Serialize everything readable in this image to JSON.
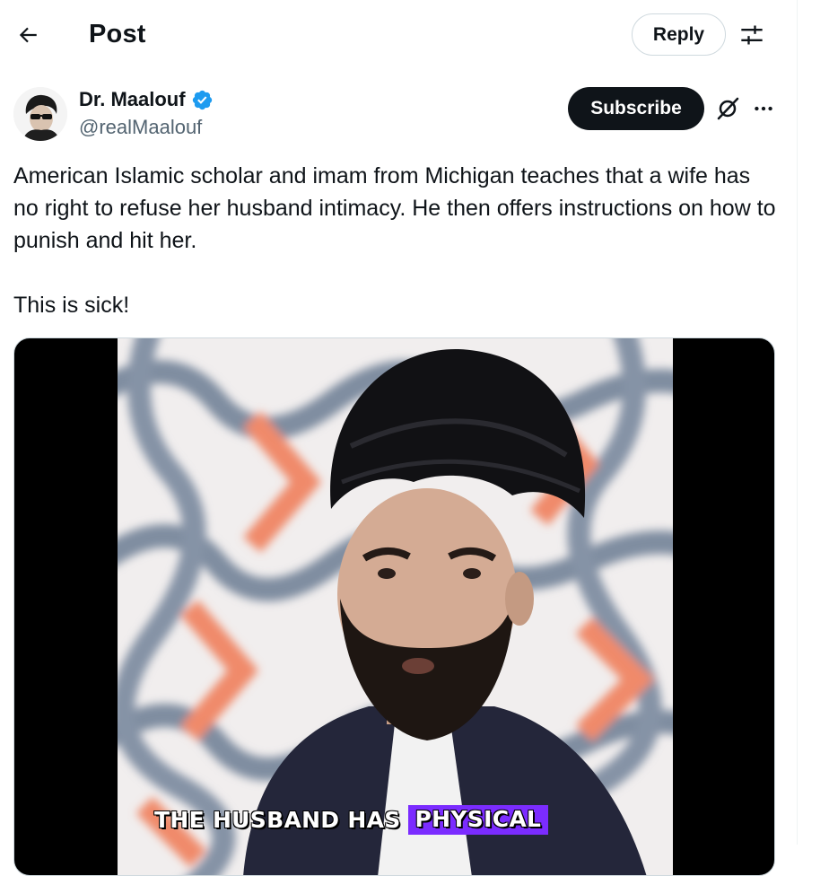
{
  "header": {
    "title": "Post",
    "reply_label": "Reply",
    "back_icon": "arrow-left-icon",
    "settings_icon": "tune-icon"
  },
  "author": {
    "name": "Dr. Maalouf",
    "handle": "@realMaalouf",
    "verified": true,
    "subscribe_label": "Subscribe",
    "grok_icon": "grok-icon",
    "more_icon": "more-icon"
  },
  "post": {
    "text_p1": "American Islamic scholar and imam from Michigan teaches that a wife has no right to refuse her husband intimacy. He then offers instructions on how to punish and hit her.",
    "text_p2": "This is sick!"
  },
  "media": {
    "caption_plain": "THE HUSBAND HAS",
    "caption_highlight": "PHYSICAL"
  },
  "colors": {
    "text": "#0f1419",
    "secondary": "#536471",
    "verified": "#1d9bf0",
    "caption_highlight": "#7b2cff"
  }
}
